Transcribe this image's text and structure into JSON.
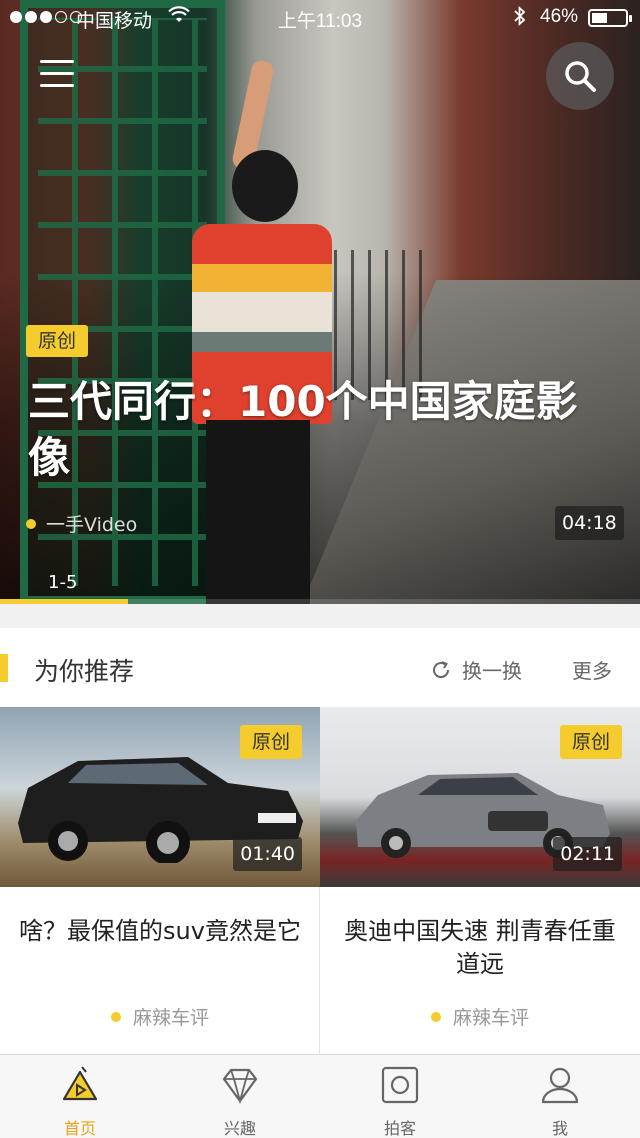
{
  "status_bar": {
    "carrier": "中国移动",
    "time": "上午11:03",
    "battery": "46%",
    "battery_level": 0.46,
    "signal_bars": 3,
    "signal_total": 5
  },
  "hero": {
    "badge": "原创",
    "title": "三代同行：100个中国家庭影像",
    "source": "一手Video",
    "duration": "04:18",
    "page_indicator": "1-5",
    "progress": 0.2
  },
  "recommend": {
    "title": "为你推荐",
    "refresh_label": "换一换",
    "more_label": "更多",
    "cards": [
      {
        "badge": "原创",
        "duration": "01:40",
        "title": "啥？最保值的suv竟然是它",
        "source": "麻辣车评"
      },
      {
        "badge": "原创",
        "duration": "02:11",
        "title": "奥迪中国失速 荆青春任重道远",
        "source": "麻辣车评"
      }
    ]
  },
  "tabs": [
    {
      "label": "首页",
      "icon": "home-play-icon",
      "active": true
    },
    {
      "label": "兴趣",
      "icon": "diamond-icon",
      "active": false
    },
    {
      "label": "拍客",
      "icon": "camera-icon",
      "active": false
    },
    {
      "label": "我",
      "icon": "person-icon",
      "active": false
    }
  ],
  "colors": {
    "accent": "#f5cc2e",
    "active_tab": "#e8a51a"
  }
}
